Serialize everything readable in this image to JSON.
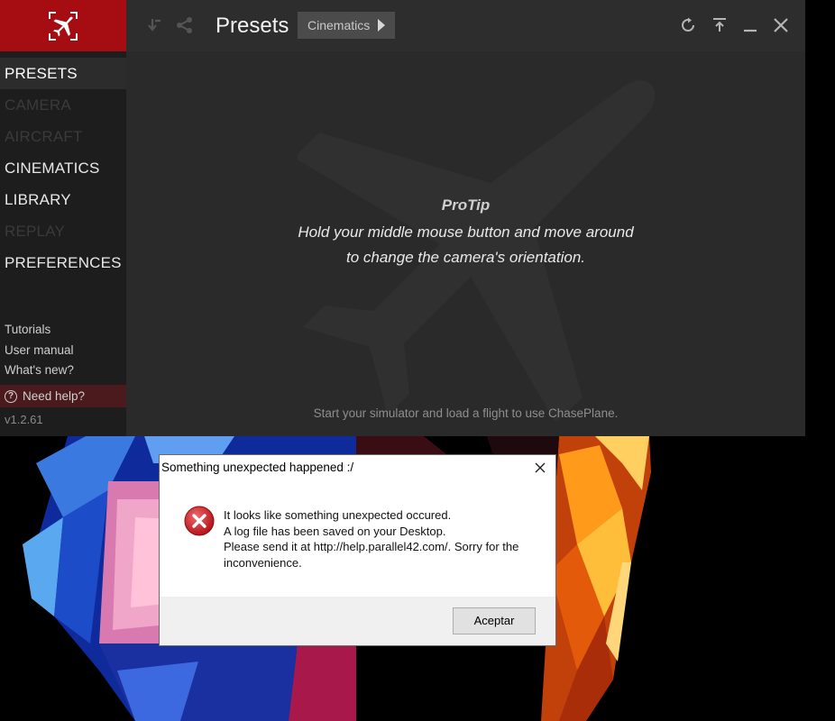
{
  "app": {
    "title": "Presets",
    "breadcrumb": "Cinematics",
    "nav": [
      {
        "label": "PRESETS",
        "state": "active"
      },
      {
        "label": "CAMERA",
        "state": "disabled"
      },
      {
        "label": "AIRCRAFT",
        "state": "disabled"
      },
      {
        "label": "CINEMATICS",
        "state": "enabled"
      },
      {
        "label": "LIBRARY",
        "state": "enabled"
      },
      {
        "label": "REPLAY",
        "state": "disabled"
      },
      {
        "label": "PREFERENCES",
        "state": "enabled"
      }
    ],
    "links": [
      "Tutorials",
      "User manual",
      "What's new?"
    ],
    "help": "Need help?",
    "version": "v1.2.61",
    "protip": {
      "title": "ProTip",
      "line1": "Hold your middle mouse button and move around",
      "line2": "to change the camera's orientation."
    },
    "status": "Start your simulator and load a flight to use ChasePlane.",
    "colors": {
      "brand": "#a60d12",
      "background": "#2a2a2a",
      "sidebar": "#1d1d1d"
    }
  },
  "dialog": {
    "title": "Something unexpected happened :/",
    "message": [
      "It looks like something unexpected occured.",
      "A log file has been saved on your Desktop.",
      "Please send it at http://help.parallel42.com/. Sorry for the",
      "inconvenience."
    ],
    "button": "Aceptar",
    "icon": "error-icon"
  }
}
